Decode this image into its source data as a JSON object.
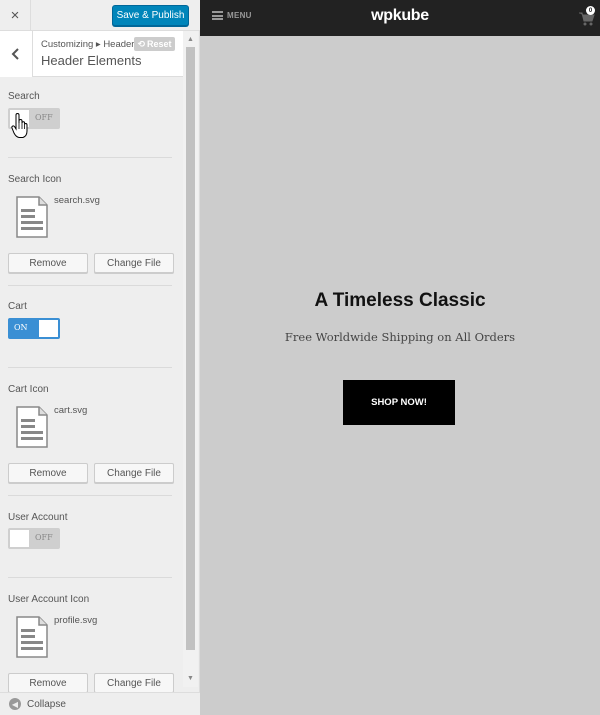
{
  "topbar": {
    "close_icon": "×",
    "publish_label": "Save & Publish"
  },
  "section": {
    "breadcrumb": "Customizing ▸ Header",
    "reset_label": "Reset",
    "reset_icon": "⟲",
    "title": "Header Elements"
  },
  "controls": {
    "search": {
      "label": "Search",
      "toggle_state": "OFF"
    },
    "search_icon": {
      "label": "Search Icon",
      "file_name": "search.svg",
      "remove_label": "Remove",
      "change_label": "Change File"
    },
    "cart": {
      "label": "Cart",
      "toggle_state": "ON"
    },
    "cart_icon": {
      "label": "Cart Icon",
      "file_name": "cart.svg",
      "remove_label": "Remove",
      "change_label": "Change File"
    },
    "user_account": {
      "label": "User Account",
      "toggle_state": "OFF"
    },
    "user_account_icon": {
      "label": "User Account Icon",
      "file_name": "profile.svg",
      "remove_label": "Remove",
      "change_label": "Change File"
    }
  },
  "footer": {
    "collapse_label": "Collapse"
  },
  "preview": {
    "menu_label": "MENU",
    "logo": "wpkube",
    "cart_count": "0",
    "hero_title": "A Timeless Classic",
    "hero_subtitle": "Free Worldwide Shipping on All Orders",
    "cta_label": "SHOP NOW!"
  },
  "colors": {
    "publish_button": "#0085ba",
    "toggle_on": "#3a8fd4",
    "toggle_off": "#cfcfcf",
    "site_header": "#222222",
    "preview_background": "#cccccc",
    "cta_background": "#000000"
  },
  "icons": {
    "close": "close-icon",
    "back": "chevron-left-icon",
    "reset": "reset-icon",
    "file": "document-icon",
    "menu": "hamburger-icon",
    "cart": "cart-icon",
    "collapse": "collapse-arrow-icon",
    "cursor": "hand-pointer-icon"
  }
}
